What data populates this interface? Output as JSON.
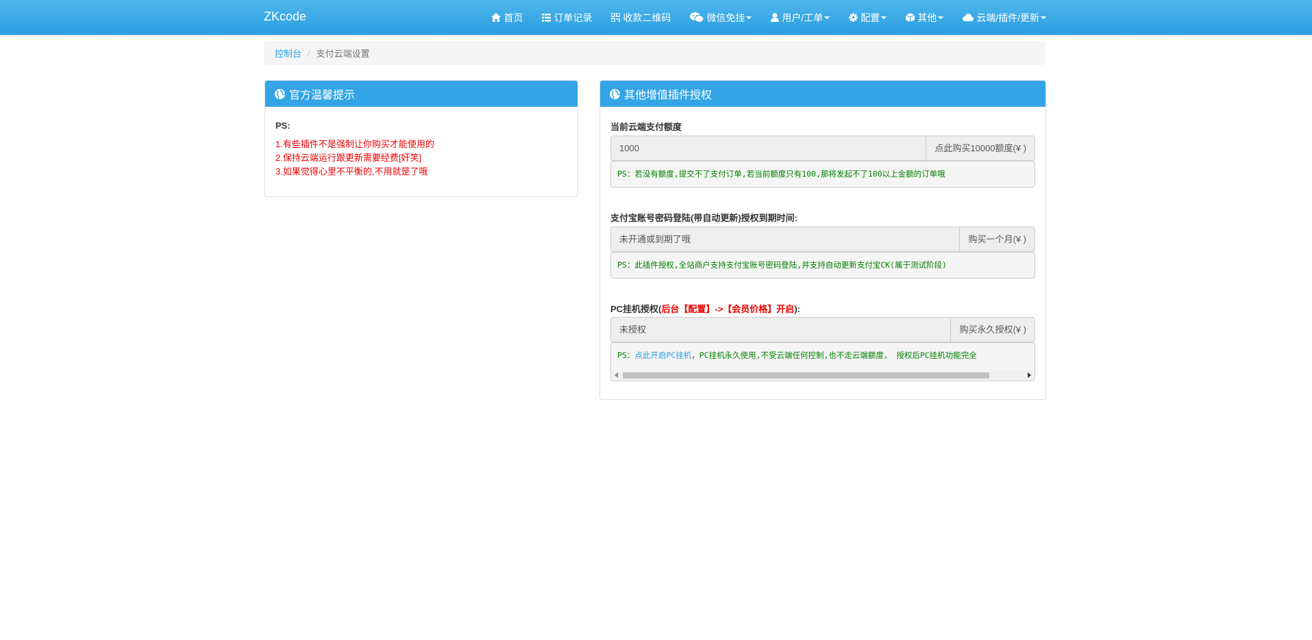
{
  "brand": "ZKcode",
  "nav": {
    "home": "首页",
    "orders": "订单记录",
    "qrcode": "收款二维码",
    "wechat": "微信免挂",
    "users": "用户/工单",
    "config": "配置",
    "other": "其他",
    "cloud": "云端/插件/更新"
  },
  "breadcrumb": {
    "home": "控制台",
    "separator": "/",
    "current": "支付云端设置"
  },
  "left_panel": {
    "title": "官方温馨提示",
    "ps_title": "PS:",
    "lines": [
      "1.有些插件不是强制让你购买才能使用的",
      "2.保持云端运行跟更新需要经费[奸笑]",
      "3.如果觉得心里不平衡的,不用就是了哦"
    ]
  },
  "right_panel": {
    "title": "其他增值插件授权",
    "quota": {
      "label": "当前云端支付额度",
      "value": "1000",
      "button": "点此购买10000额度(¥ )",
      "note": "PS：若没有额度,提交不了支付订单,若当前额度只有100,那将发起不了100以上金额的订单哦"
    },
    "alipay": {
      "label": "支付宝账号密码登陆(带自动更新)授权到期时间:",
      "value": "未开通或到期了哦",
      "button": "购买一个月(¥ )",
      "note": "PS：此插件授权,全站商户支持支付宝账号密码登陆,并支持自动更新支付宝CK(属于测试阶段)"
    },
    "pc": {
      "label_prefix": "PC挂机授权(",
      "label_red": "后台【配置】->【会员价格】开启",
      "label_suffix": "):",
      "value": "未授权",
      "button": "购买永久授权(¥ )",
      "note_prefix": "PS：",
      "note_link": "点此开启PC挂机",
      "note_rest": "，PC挂机永久使用,不受云端任何控制,也不走云端额度， 授权后PC挂机功能完全"
    }
  },
  "colors": {
    "navbar": "#2a9ee0",
    "panel_heading": "#33a5e6",
    "warning_text": "#e00000",
    "code_text": "#008000"
  },
  "icons": [
    "home-icon",
    "list-icon",
    "qrcode-icon",
    "wechat-icon",
    "user-icon",
    "gear-icon",
    "box-icon",
    "cloud-icon",
    "globe-icon"
  ]
}
